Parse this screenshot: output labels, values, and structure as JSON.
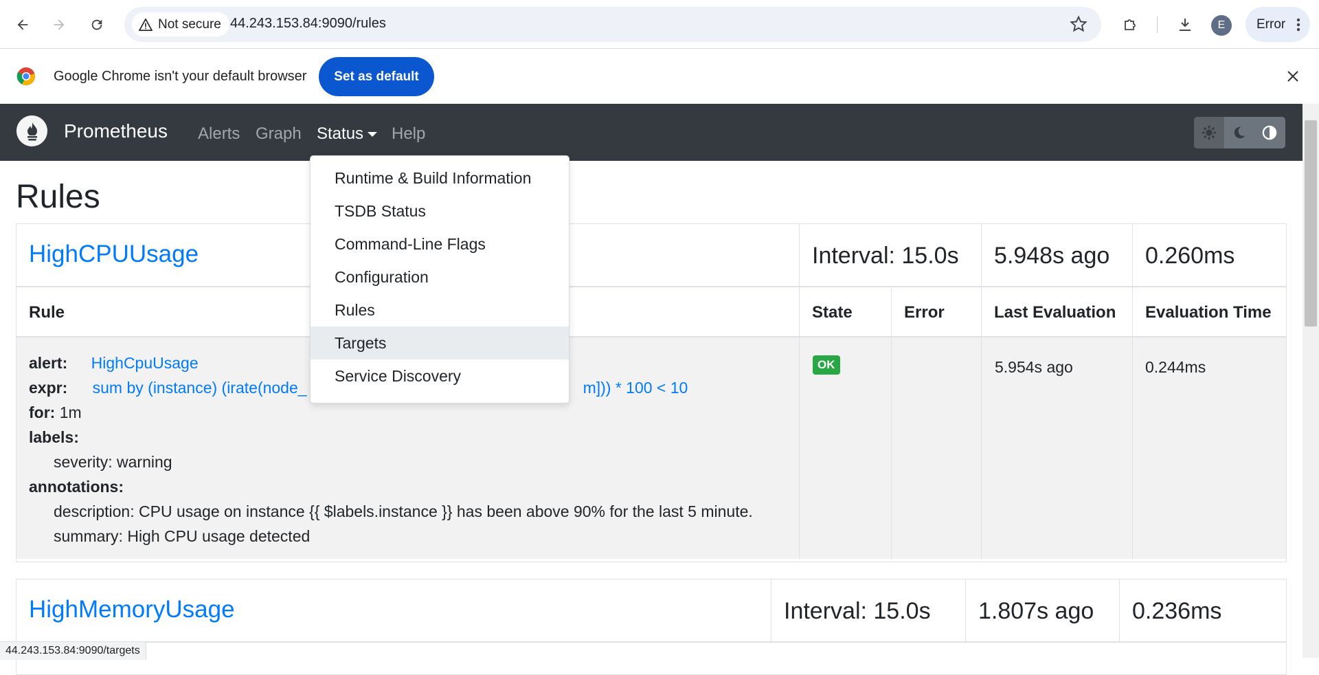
{
  "browser": {
    "security_label": "Not secure",
    "url": "44.243.153.84:9090/rules",
    "profile_initial": "E",
    "error_label": "Error"
  },
  "infobar": {
    "message": "Google Chrome isn't your default browser",
    "set_default_label": "Set as default"
  },
  "navbar": {
    "brand": "Prometheus",
    "links": [
      "Alerts",
      "Graph",
      "Status",
      "Help"
    ]
  },
  "dropdown": {
    "items": [
      "Runtime & Build Information",
      "TSDB Status",
      "Command-Line Flags",
      "Configuration",
      "Rules",
      "Targets",
      "Service Discovery"
    ],
    "hovered": "Targets"
  },
  "page": {
    "title": "Rules"
  },
  "columns": {
    "rule": "Rule",
    "state": "State",
    "error": "Error",
    "last_evaluation": "Last Evaluation",
    "evaluation_time": "Evaluation Time"
  },
  "groups": [
    {
      "name": "HighCPUUsage",
      "interval": "Interval: 15.0s",
      "last_eval": "5.948s ago",
      "eval_time": "0.260ms",
      "rule": {
        "alert_key": "alert:",
        "alert_name": "HighCpuUsage",
        "expr_key": "expr:",
        "expr_left": "sum by (instance) (irate(node_",
        "expr_right": "m])) * 100 < 10",
        "for_key": "for:",
        "for_value": "1m",
        "labels_key": "labels:",
        "label_severity": "severity: warning",
        "annotations_key": "annotations:",
        "annotation_description": "description: CPU usage on instance {{ $labels.instance }} has been above 90% for the last 5 minute.",
        "annotation_summary": "summary: High CPU usage detected",
        "state": "OK",
        "error": "",
        "last_evaluation": "5.954s ago",
        "evaluation_time": "0.244ms"
      }
    },
    {
      "name": "HighMemoryUsage",
      "interval": "Interval: 15.0s",
      "last_eval": "1.807s ago",
      "eval_time": "0.236ms"
    }
  ],
  "status_bar": {
    "link_url": "44.243.153.84:9090/targets"
  }
}
